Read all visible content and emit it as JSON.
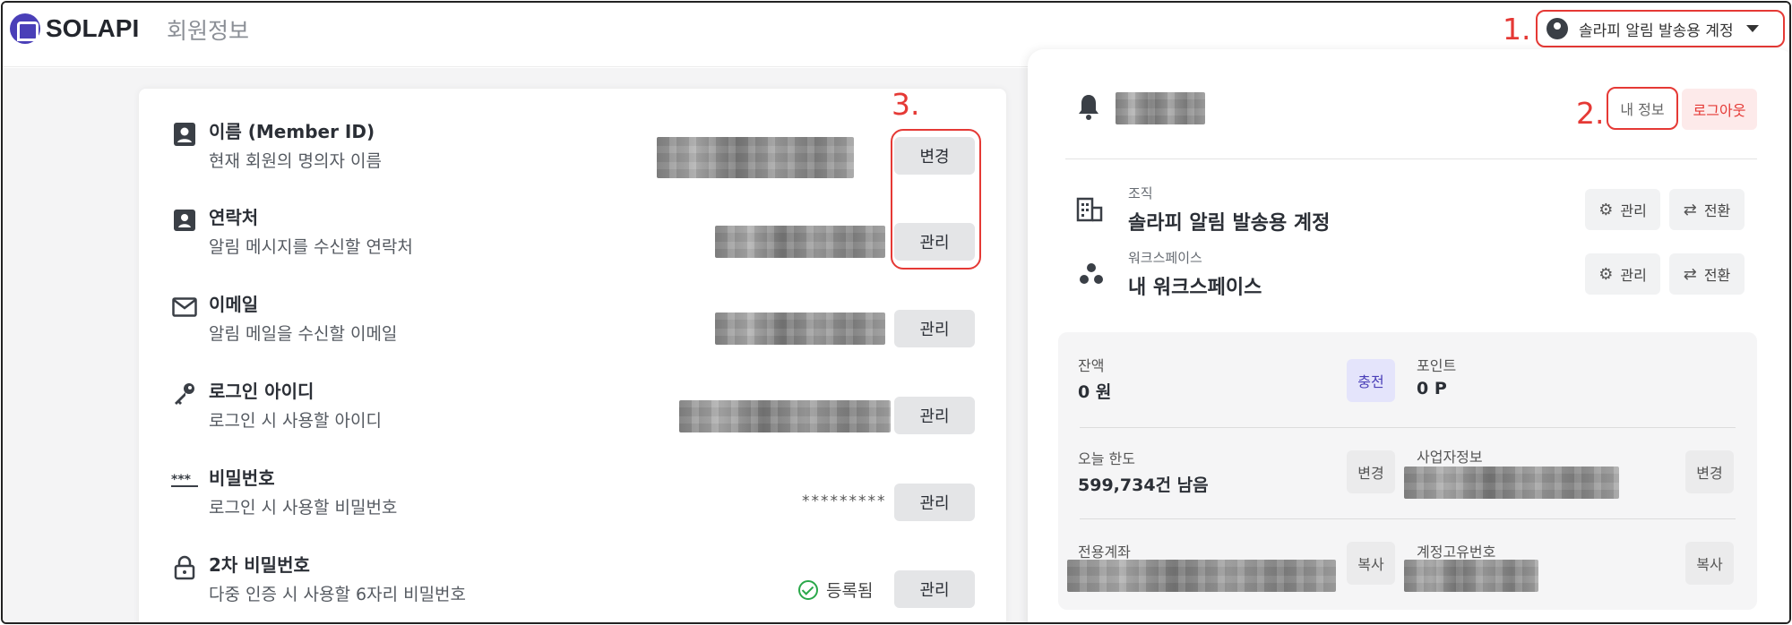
{
  "header": {
    "logo_text": "SOLAPI",
    "page_title": "회원정보",
    "account_button_label": "솔라피 알림 발송용 계정"
  },
  "annotations": {
    "step1": "1.",
    "step2": "2.",
    "step3": "3.",
    "highlight_color": "#e53935"
  },
  "profile": {
    "rows": [
      {
        "title": "이름 (Member ID)",
        "desc": "현재 회원의 명의자 이름",
        "button": "변경",
        "icon": "person-badge-icon"
      },
      {
        "title": "연락처",
        "desc": "알림 메시지를 수신할 연락처",
        "button": "관리",
        "icon": "contact-card-icon"
      },
      {
        "title": "이메일",
        "desc": "알림 메일을 수신할 이메일",
        "button": "관리",
        "icon": "mail-icon"
      },
      {
        "title": "로그인 아이디",
        "desc": "로그인 시 사용할 아이디",
        "button": "관리",
        "icon": "key-icon"
      },
      {
        "title": "비밀번호",
        "desc": "로그인 시 사용할 비밀번호",
        "button": "관리",
        "icon": "password-icon",
        "value": "*********"
      },
      {
        "title": "2차 비밀번호",
        "desc": "다중 인증 시 사용할 6자리 비밀번호",
        "button": "관리",
        "icon": "lock-icon",
        "status": "등록됨"
      }
    ]
  },
  "account_panel": {
    "my_info_button": "내 정보",
    "logout_button": "로그아웃",
    "organization": {
      "label": "조직",
      "name": "솔라피 알림 발송용 계정",
      "manage": "관리",
      "switch": "전환"
    },
    "workspace": {
      "label": "워크스페이스",
      "name": "내 워크스페이스",
      "manage": "관리",
      "switch": "전환"
    },
    "balance": {
      "label": "잔액",
      "value": "0 원",
      "charge_button": "충전"
    },
    "points": {
      "label": "포인트",
      "value": "0 P"
    },
    "daily_limit": {
      "label": "오늘 한도",
      "value": "599,734건 남음",
      "change_button": "변경"
    },
    "business_info": {
      "label": "사업자정보",
      "change_button": "변경"
    },
    "dedicated_account": {
      "label": "전용계좌",
      "copy_button": "복사"
    },
    "account_id": {
      "label": "계정고유번호",
      "copy_button": "복사"
    }
  }
}
